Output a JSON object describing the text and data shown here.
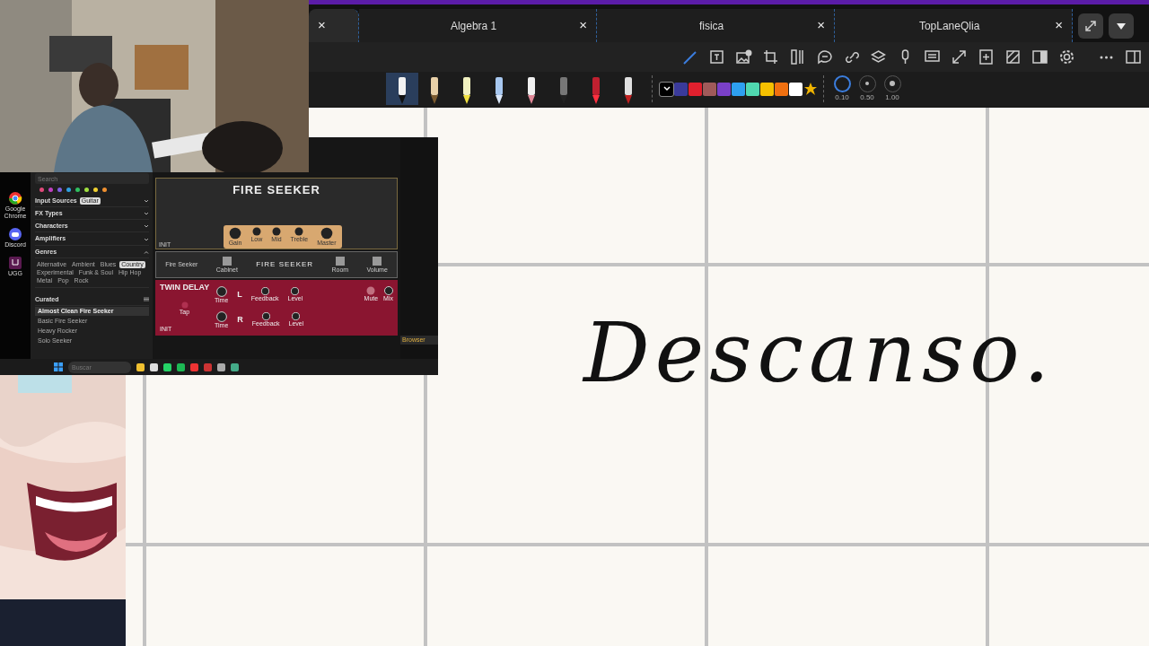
{
  "tabs": [
    {
      "close": "×",
      "selected": true
    },
    {
      "label": "Algebra 1",
      "close": "×",
      "selected": false
    },
    {
      "label": "fisica",
      "close": "×",
      "selected": false
    },
    {
      "label": "TopLaneQlia",
      "close": "×",
      "selected": false
    }
  ],
  "pens": [
    {
      "kind": "fountain",
      "selected": true
    },
    {
      "kind": "pencil",
      "selected": false
    },
    {
      "kind": "highlighter",
      "selected": false
    },
    {
      "kind": "tape",
      "selected": false
    },
    {
      "kind": "eraser",
      "selected": false
    },
    {
      "kind": "brush",
      "selected": false
    },
    {
      "kind": "marker",
      "selected": false
    },
    {
      "kind": "ballpoint",
      "selected": false
    }
  ],
  "colors": [
    {
      "color": "#000000",
      "selected": true
    },
    {
      "color": "#3a3a9a",
      "selected": false
    },
    {
      "color": "#e0202e",
      "selected": false
    },
    {
      "color": "#a05a5a",
      "selected": false
    },
    {
      "color": "#7a40c8",
      "selected": false
    },
    {
      "color": "#2ea0f0",
      "selected": false
    },
    {
      "color": "#50d8b0",
      "selected": false
    },
    {
      "color": "#f5c000",
      "selected": false
    },
    {
      "color": "#f07010",
      "selected": false
    },
    {
      "color": "#ffffff",
      "selected": false
    }
  ],
  "widths": [
    {
      "label": "0.10",
      "selected": true
    },
    {
      "label": "0.50",
      "selected": false
    },
    {
      "label": "1.00",
      "selected": false
    }
  ],
  "note": {
    "handwriting": "Descanso."
  },
  "captured_screen": {
    "desktop_icons": [
      {
        "label": "Google Chrome",
        "kind": "chrome"
      },
      {
        "label": "Discord",
        "kind": "discord"
      },
      {
        "label": "UGG",
        "kind": "app"
      }
    ],
    "search_placeholder": "Search",
    "tag_dots": [
      {
        "color": "#e04a7a"
      },
      {
        "color": "#c040c0"
      },
      {
        "color": "#8060e0"
      },
      {
        "color": "#30a0e0"
      },
      {
        "color": "#30c060"
      },
      {
        "color": "#a0e040"
      },
      {
        "color": "#f0d030"
      },
      {
        "color": "#f09030"
      }
    ],
    "filters": [
      {
        "label": "Input Sources",
        "expanded": false,
        "tags": [
          {
            "label": "Guitar",
            "selected": true
          }
        ]
      },
      {
        "label": "FX Types",
        "expanded": false
      },
      {
        "label": "Characters",
        "expanded": false
      },
      {
        "label": "Amplifiers",
        "expanded": false
      },
      {
        "label": "Genres",
        "expanded": true,
        "tags": [
          {
            "label": "Alternative",
            "selected": false
          },
          {
            "label": "Ambient",
            "selected": false
          },
          {
            "label": "Blues",
            "selected": false
          },
          {
            "label": "Country",
            "selected": true
          },
          {
            "label": "Experimental",
            "selected": false
          },
          {
            "label": "Funk & Soul",
            "selected": false
          },
          {
            "label": "Hip Hop",
            "selected": false
          },
          {
            "label": "Metal",
            "selected": false
          },
          {
            "label": "Pop",
            "selected": false
          },
          {
            "label": "Rock",
            "selected": false
          }
        ]
      }
    ],
    "curated": {
      "title": "Curated",
      "presets": [
        {
          "label": "Almost Clean Fire Seeker",
          "selected": true
        },
        {
          "label": "Basic Fire Seeker",
          "selected": false
        },
        {
          "label": "Heavy Rocker",
          "selected": false
        },
        {
          "label": "Solo Seeker",
          "selected": false
        }
      ]
    },
    "amp": {
      "title": "FIRE SEEKER",
      "preset": "INIT",
      "knobs": [
        "Gain",
        "Low",
        "Mid",
        "Treble",
        "Master"
      ]
    },
    "cabinet": {
      "title": "FIRE SEEKER",
      "preset": "Fire Seeker",
      "controls": [
        "Cabinet",
        "Room",
        "Volume"
      ]
    },
    "delay": {
      "title": "TWIN DELAY",
      "preset": "INIT",
      "tap": "Tap",
      "mute": "Mute",
      "mix": "Mix",
      "rows": [
        {
          "channel": "L",
          "knobs": [
            "Time",
            "Feedback",
            "Level"
          ]
        },
        {
          "channel": "R",
          "knobs": [
            "Time",
            "Feedback",
            "Level"
          ]
        }
      ]
    },
    "taskbar": {
      "search_placeholder": "Buscar"
    },
    "side_panel": {
      "title": "Browser"
    }
  }
}
